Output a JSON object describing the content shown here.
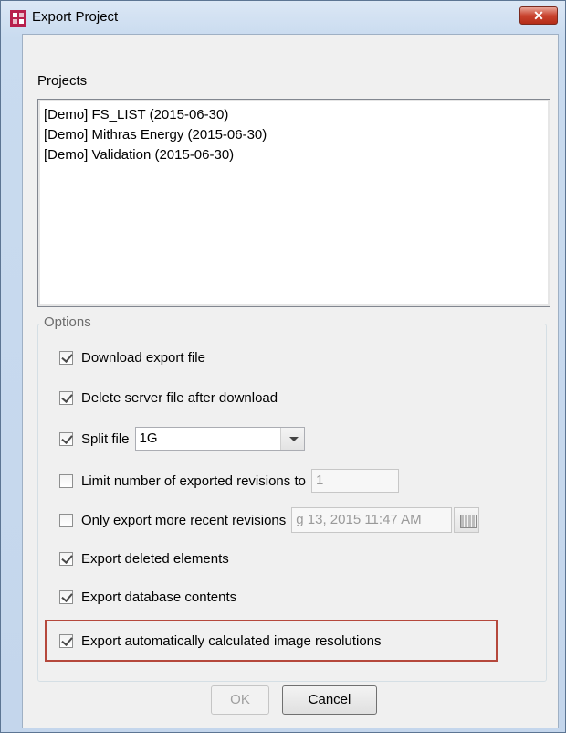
{
  "window": {
    "title": "Export Project",
    "close_label": "✕"
  },
  "projects": {
    "label": "Projects",
    "items": [
      "[Demo] FS_LIST (2015-06-30)",
      "[Demo] Mithras Energy (2015-06-30)",
      "[Demo] Validation (2015-06-30)"
    ]
  },
  "options": {
    "legend": "Options",
    "download": {
      "label": "Download export file",
      "checked": true
    },
    "delete_server": {
      "label": "Delete server file after download",
      "checked": true
    },
    "split": {
      "label": "Split file",
      "checked": true,
      "value": "1G"
    },
    "limit": {
      "label": "Limit number of exported revisions to",
      "checked": false,
      "value": "1"
    },
    "recent": {
      "label": "Only export more recent revisions",
      "checked": false,
      "value": "g 13, 2015 11:47 AM"
    },
    "deleted_elements": {
      "label": "Export deleted elements",
      "checked": true
    },
    "db_contents": {
      "label": "Export database contents",
      "checked": true
    },
    "image_res": {
      "label": "Export automatically calculated image resolutions",
      "checked": true
    }
  },
  "buttons": {
    "ok": "OK",
    "cancel": "Cancel"
  },
  "colors": {
    "highlight": "#b5483c",
    "close": "#c9432f"
  }
}
